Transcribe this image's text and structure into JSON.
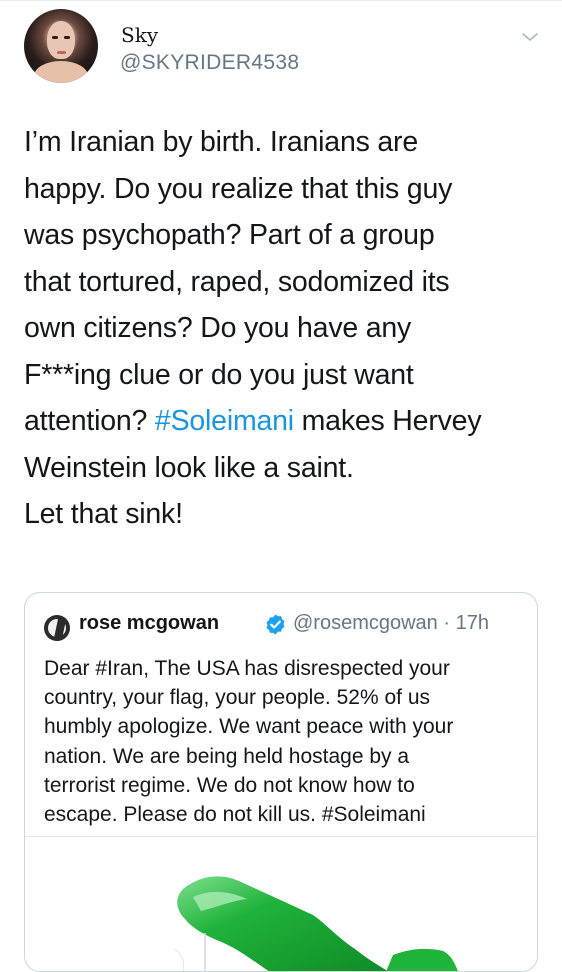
{
  "tweet": {
    "display_name": "Sky",
    "handle": "@SKYRIDER4538",
    "avatar_icon": "profile-photo",
    "menu_icon": "chevron-down-icon",
    "text_lines": [
      {
        "text": "I’m Iranian by birth. Iranians are"
      },
      {
        "text": "happy. Do you realize that this guy"
      },
      {
        "text": "was psychopath? Part of a group"
      },
      {
        "text": "that tortured, raped, sodomized its"
      },
      {
        "text": "own citizens? Do you have any"
      },
      {
        "text": "F***ing clue or do you just want"
      },
      {
        "before": "attention? ",
        "hashtag": "#Soleimani",
        "after": " makes Hervey"
      },
      {
        "text": "Weinstein look like a saint."
      },
      {
        "text": "Let that sink!"
      }
    ],
    "hashtag_color": "#1b95e0"
  },
  "quoted_tweet": {
    "display_name": "rose mcgowan",
    "handle": "@rosemcgowan",
    "separator": "·",
    "time": "17h",
    "verified_icon": "verified-badge-icon",
    "verified_color": "#1da1f2",
    "text_lines": [
      "Dear #Iran, The USA has disrespected your",
      "country, your flag, your people. 52% of us",
      "humbly apologize. We want peace with your",
      "nation. We are being held hostage by a",
      "terrorist regime. We do not know how to",
      "escape. Please do not kill us. #Soleimani"
    ],
    "media_description_icon": "waving-flag-image",
    "flag_color": "#1fb33a"
  }
}
